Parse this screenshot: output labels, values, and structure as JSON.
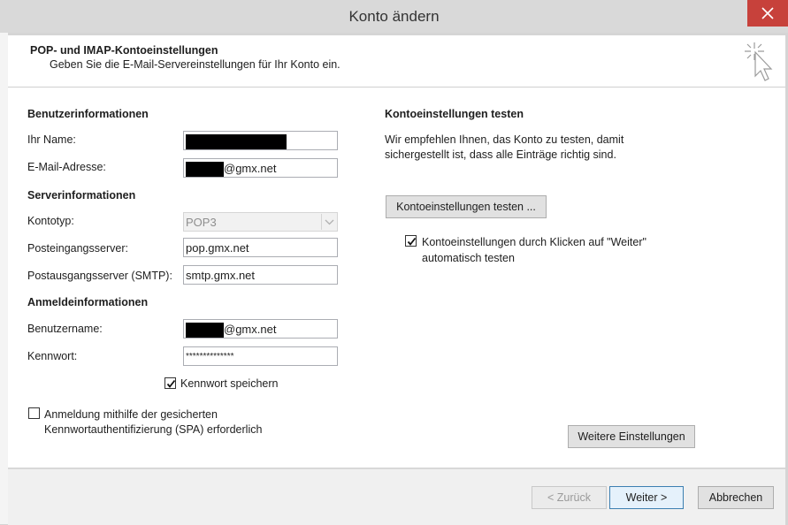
{
  "window": {
    "title": "Konto ändern",
    "close_glyph": "close-icon"
  },
  "header": {
    "title": "POP- und IMAP-Kontoeinstellungen",
    "subtitle": "Geben Sie die E-Mail-Servereinstellungen für Ihr Konto ein."
  },
  "user_info": {
    "heading": "Benutzerinformationen",
    "name_label": "Ihr Name:",
    "email_label": "E-Mail-Adresse:",
    "email_suffix": "@gmx.net"
  },
  "server_info": {
    "heading": "Serverinformationen",
    "account_type_label": "Kontotyp:",
    "account_type_value": "POP3",
    "incoming_label": "Posteingangsserver:",
    "incoming_value": "pop.gmx.net",
    "outgoing_label": "Postausgangsserver (SMTP):",
    "outgoing_value": "smtp.gmx.net"
  },
  "login_info": {
    "heading": "Anmeldeinformationen",
    "username_label": "Benutzername:",
    "username_suffix": "@gmx.net",
    "password_label": "Kennwort:",
    "password_value": "**************",
    "remember_password_label": "Kennwort speichern",
    "remember_password_checked": true,
    "spa_label_line1": "Anmeldung mithilfe der gesicherten",
    "spa_label_line2": "Kennwortauthentifizierung (SPA) erforderlich",
    "spa_checked": false
  },
  "test_settings": {
    "heading": "Kontoeinstellungen testen",
    "description_line1": "Wir empfehlen Ihnen, das Konto zu testen, damit",
    "description_line2": "sichergestellt ist, dass alle Einträge richtig sind.",
    "test_button": "Kontoeinstellungen testen ...",
    "auto_test_line1": "Kontoeinstellungen durch Klicken auf \"Weiter\"",
    "auto_test_line2": "automatisch testen",
    "auto_test_checked": true,
    "more_settings_button": "Weitere Einstellungen"
  },
  "footer": {
    "back_button": "< Zurück",
    "next_button": "Weiter >",
    "cancel_button": "Abbrechen"
  },
  "colors": {
    "close_button": "#c7413b",
    "default_button_border": "#3c7fb1"
  }
}
